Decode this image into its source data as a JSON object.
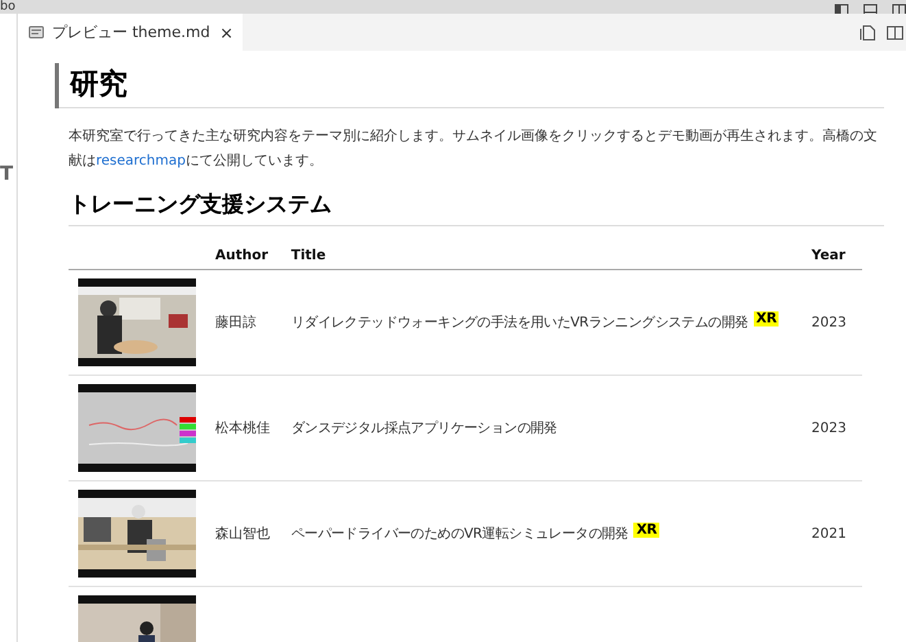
{
  "title_bar": {
    "text": "bo"
  },
  "tabs": [
    {
      "label": "プレビュー theme.md",
      "selected": true,
      "close": "×"
    }
  ],
  "sidebar": {
    "glyph": "T"
  },
  "document": {
    "heading": "研究",
    "intro": {
      "before": "本研究室で行ってきた主な研究内容をテーマ別に紹介します。サムネイル画像をクリックするとデモ動画が再生されます。高橋の文献は",
      "link": "researchmap",
      "after": "にて公開しています。"
    },
    "section": "トレーニング支援システム",
    "table": {
      "columns": [
        "",
        "Author",
        "Title",
        "Year"
      ],
      "rows": [
        {
          "thumbnail": {
            "kind": "picture"
          },
          "author": "藤田諒",
          "title": "リダイレクテッドウォーキングの手法を用いたVRランニングシステムの開発",
          "badge": "XR",
          "year": "2023"
        },
        {
          "thumbnail": {
            "kind": "picture"
          },
          "author": "松本桃佳",
          "title": "ダンスデジタル採点アプリケーションの開発",
          "year": "2023"
        },
        {
          "thumbnail": {
            "kind": "picture"
          },
          "author": "森山智也",
          "title": "ペーパードライバーのためのVR運転シミュレータの開発",
          "badge": "XR",
          "year": "2021"
        },
        {
          "thumbnail": {
            "kind": "picture"
          }
        }
      ]
    }
  }
}
